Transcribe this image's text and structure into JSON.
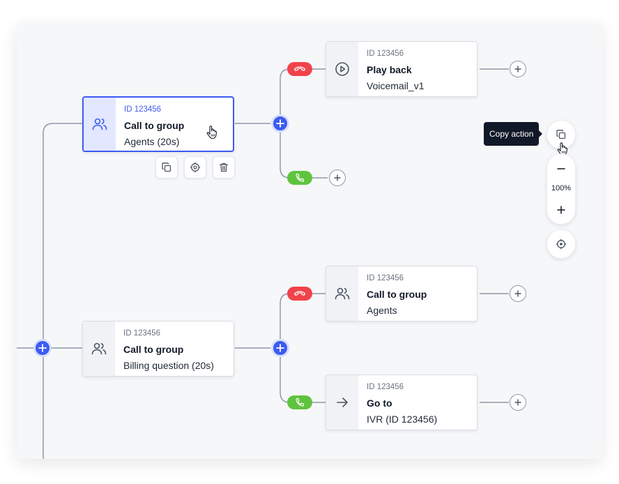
{
  "nodes": {
    "group_agents20": {
      "id": "ID 123456",
      "title": "Call to group",
      "subtitle": "Agents (20s)",
      "icon": "users-icon"
    },
    "playback": {
      "id": "ID 123456",
      "title": "Play back",
      "subtitle": "Voicemail_v1",
      "icon": "play-circle-icon"
    },
    "group_billing": {
      "id": "ID 123456",
      "title": "Call to group",
      "subtitle": "Billing question (20s)",
      "icon": "users-icon"
    },
    "group_agents": {
      "id": "ID 123456",
      "title": "Call to group",
      "subtitle": "Agents",
      "icon": "users-icon"
    },
    "goto": {
      "id": "ID 123456",
      "title": "Go to",
      "subtitle": "IVR (ID 123456)",
      "icon": "arrow-right-icon"
    }
  },
  "node_actions": [
    "copy-icon",
    "target-icon",
    "trash-icon"
  ],
  "tooltip": {
    "label": "Copy action"
  },
  "zoom": {
    "level": "100%"
  },
  "colors": {
    "accent": "#3d5af1",
    "hangup": "#f0434b",
    "answer": "#5fc43d",
    "connector": "#8d98a9",
    "canvas": "#f6f7f9"
  }
}
